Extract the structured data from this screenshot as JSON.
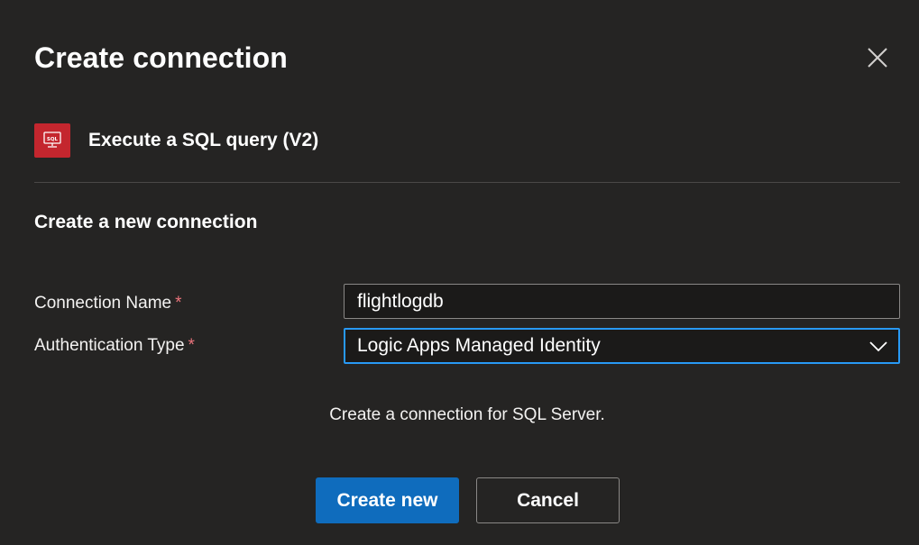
{
  "dialog": {
    "title": "Create connection"
  },
  "action": {
    "icon": "sql-server-icon",
    "icon_badge": "SQL",
    "icon_color": "#c4262e",
    "name": "Execute a SQL query (V2)"
  },
  "form": {
    "section_title": "Create a new connection",
    "connection_name": {
      "label": "Connection Name",
      "required_marker": "*",
      "value": "flightlogdb"
    },
    "authentication_type": {
      "label": "Authentication Type",
      "required_marker": "*",
      "selected": "Logic Apps Managed Identity"
    },
    "helper_text": "Create a connection for SQL Server."
  },
  "buttons": {
    "create_new": "Create new",
    "cancel": "Cancel"
  },
  "colors": {
    "background": "#252423",
    "primary": "#0f6cbd",
    "focus_border": "#2899f5",
    "required": "#e9737b"
  }
}
